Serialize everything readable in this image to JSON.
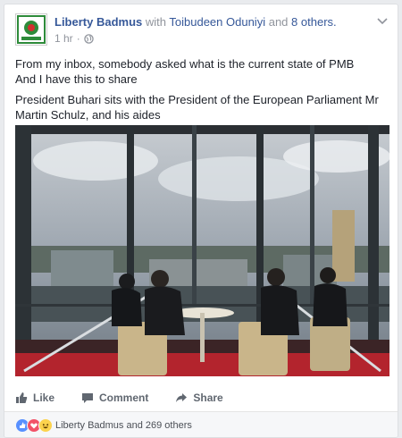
{
  "post": {
    "author": "Liberty Badmus",
    "with_word": "with",
    "tagged": "Toibudeen Oduniyi",
    "and_word": "and",
    "others": "8 others.",
    "time": "1 hr",
    "dot": "·",
    "lines": [
      "From my inbox, somebody asked what is the current state of PMB",
      "And I have this to share",
      "President Buhari sits with the President of the European Parliament Mr Martin Schulz, and his aides"
    ]
  },
  "actions": {
    "like": "Like",
    "comment": "Comment",
    "share": "Share"
  },
  "reactions": {
    "summary": "Liberty Badmus and 269 others",
    "icons": [
      "like-icon",
      "love-icon",
      "haha-icon"
    ],
    "colors": {
      "like": "#5890ff",
      "love": "#f25268",
      "haha": "#fcd34d"
    }
  },
  "colors": {
    "link": "#365899",
    "muted": "#90949c",
    "text": "#1d2129"
  }
}
